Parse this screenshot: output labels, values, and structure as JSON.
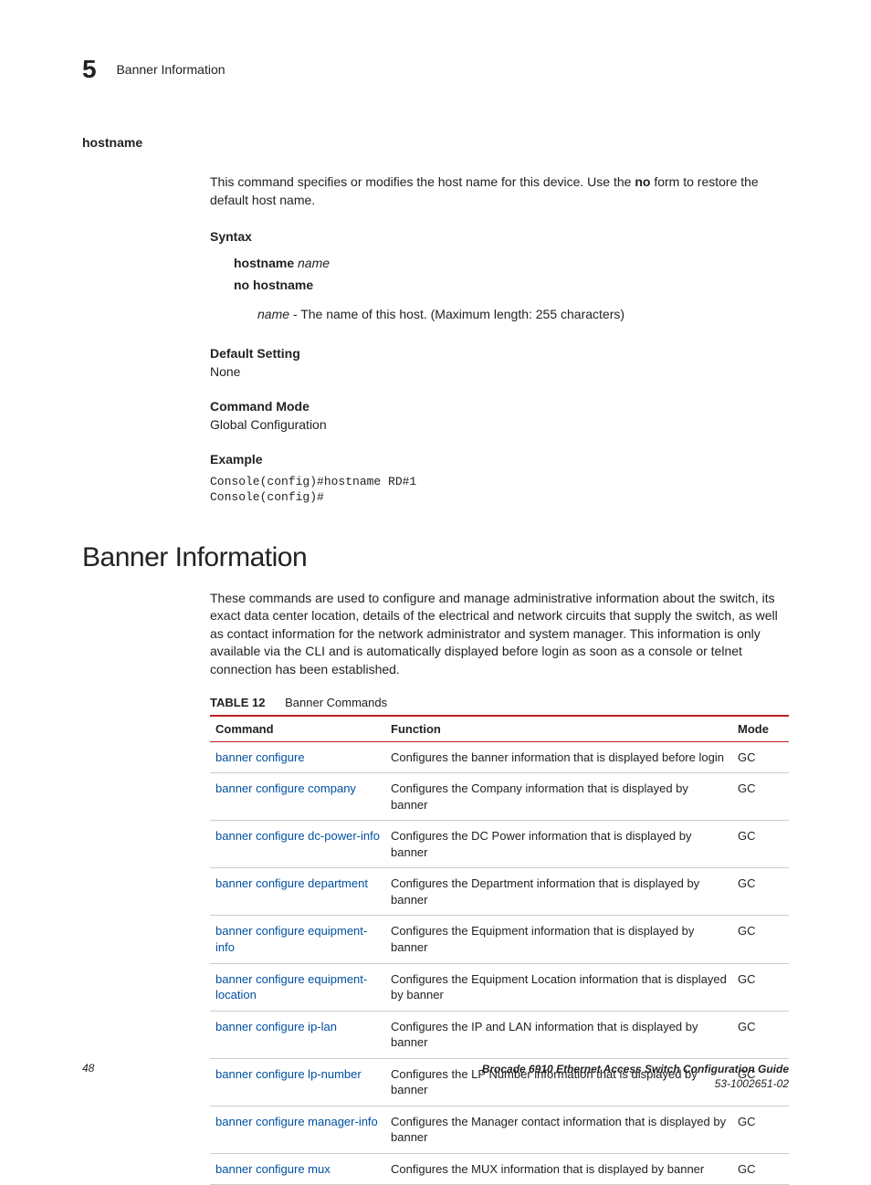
{
  "header": {
    "chapter": "5",
    "breadcrumb": "Banner Information"
  },
  "hostname": {
    "title": "hostname",
    "desc_pre": "This command specifies or modifies the host name for this device. Use the ",
    "desc_bold": "no",
    "desc_post": " form to restore the default host name.",
    "syntax_label": "Syntax",
    "syntax_cmd": "hostname",
    "syntax_arg": "name",
    "syntax_no": "no hostname",
    "syntax_arg_desc_name": "name",
    "syntax_arg_desc_rest": " - The name of this host. (Maximum length: 255 characters)",
    "default_label": "Default Setting",
    "default_value": "None",
    "mode_label": "Command Mode",
    "mode_value": "Global Configuration",
    "example_label": "Example",
    "example_code": "Console(config)#hostname RD#1\nConsole(config)#"
  },
  "section": {
    "title": "Banner Information",
    "intro": "These commands are used to configure and manage administrative information about the switch, its exact data center location, details of the electrical and network circuits that supply the switch, as well as contact information for the network administrator and system manager. This information is only available via the CLI and is automatically displayed before login as soon as a console or telnet connection has been established.",
    "table_label": "TABLE 12",
    "table_caption": "Banner Commands",
    "columns": {
      "c1": "Command",
      "c2": "Function",
      "c3": "Mode"
    },
    "rows": [
      {
        "cmd": "banner configure",
        "func": "Configures the banner information that is displayed before login",
        "mode": "GC"
      },
      {
        "cmd": "banner configure company",
        "func": "Configures the Company information that is displayed by banner",
        "mode": "GC"
      },
      {
        "cmd": "banner configure dc-power-info",
        "func": "Configures the DC Power information that is displayed by banner",
        "mode": "GC"
      },
      {
        "cmd": "banner configure department",
        "func": "Configures the Department information that is displayed by banner",
        "mode": "GC"
      },
      {
        "cmd": "banner configure equipment-info",
        "func": "Configures the Equipment information that is displayed by banner",
        "mode": "GC"
      },
      {
        "cmd": "banner configure equipment-location",
        "func": "Configures the Equipment Location information that is displayed by banner",
        "mode": "GC"
      },
      {
        "cmd": "banner configure ip-lan",
        "func": "Configures the IP and LAN information that is displayed by banner",
        "mode": "GC"
      },
      {
        "cmd": "banner configure lp-number",
        "func": "Configures the LP Number information that is displayed by banner",
        "mode": "GC"
      },
      {
        "cmd": "banner configure manager-info",
        "func": "Configures the Manager contact information that is displayed by banner",
        "mode": "GC"
      },
      {
        "cmd": "banner configure mux",
        "func": "Configures the MUX information that is displayed by banner",
        "mode": "GC"
      }
    ]
  },
  "footer": {
    "page": "48",
    "doc_title": "Brocade 6910 Ethernet Access Switch Configuration Guide",
    "doc_num": "53-1002651-02"
  }
}
